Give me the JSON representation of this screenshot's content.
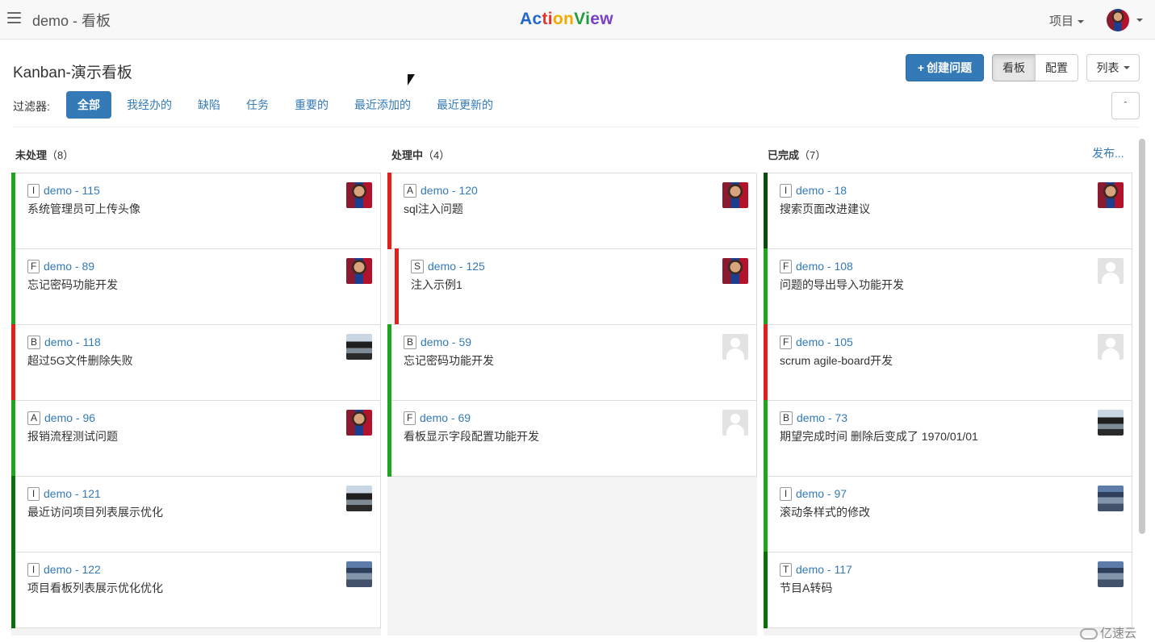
{
  "nav": {
    "app_title": "demo - 看板",
    "brand": [
      "Ac",
      "ti",
      "on",
      "Vi",
      "ew"
    ],
    "project_menu": "项目"
  },
  "header": {
    "board_title": "Kanban-演示看板",
    "create_button": "创建问题",
    "view_board": "看板",
    "view_config": "配置",
    "list_menu": "列表"
  },
  "filters": {
    "label": "过滤器:",
    "items": [
      "全部",
      "我经办的",
      "缺陷",
      "任务",
      "重要的",
      "最近添加的",
      "最近更新的"
    ],
    "active": "全部"
  },
  "columns": [
    {
      "name": "未处理",
      "count": "（8）",
      "cards": [
        {
          "type": "I",
          "key": "demo - 115",
          "title": "系统管理员可上传头像",
          "stripe": "#1ea41e",
          "avatar": "player"
        },
        {
          "type": "F",
          "key": "demo - 89",
          "title": "忘记密码功能开发",
          "stripe": "#1ea41e",
          "avatar": "player"
        },
        {
          "type": "B",
          "key": "demo - 118",
          "title": "超过5G文件删除失败",
          "stripe": "#e0201b",
          "avatar": "office"
        },
        {
          "type": "A",
          "key": "demo - 96",
          "title": "报销流程测试问题",
          "stripe": "#1ea41e",
          "avatar": "player"
        },
        {
          "type": "I",
          "key": "demo - 121",
          "title": "最近访问项目列表展示优化",
          "stripe": "#0d6e0d",
          "avatar": "office"
        },
        {
          "type": "I",
          "key": "demo - 122",
          "title": "项目看板列表展示优化优化",
          "stripe": "#0d6e0d",
          "avatar": "temple"
        }
      ]
    },
    {
      "name": "处理中",
      "count": "（4）",
      "cards": [
        {
          "type": "A",
          "key": "demo - 120",
          "title": "sql注入问题",
          "stripe": "#e0201b",
          "avatar": "player"
        },
        {
          "type": "S",
          "key": "demo - 125",
          "title": "注入示例1",
          "stripe": "#e0201b",
          "avatar": "player",
          "subtask": true
        },
        {
          "type": "B",
          "key": "demo - 59",
          "title": "忘记密码功能开发",
          "stripe": "#1ea41e",
          "avatar": "placeholder"
        },
        {
          "type": "F",
          "key": "demo - 69",
          "title": "看板显示字段配置功能开发",
          "stripe": "#1ea41e",
          "avatar": "placeholder"
        }
      ]
    },
    {
      "name": "已完成",
      "count": "（7）",
      "release_link": "发布...",
      "cards": [
        {
          "type": "I",
          "key": "demo - 18",
          "title": "搜索页面改进建议",
          "stripe": "#0d4a0d",
          "avatar": "player"
        },
        {
          "type": "F",
          "key": "demo - 108",
          "title": "问题的导出导入功能开发",
          "stripe": "#1ea41e",
          "avatar": "placeholder"
        },
        {
          "type": "F",
          "key": "demo - 105",
          "title": "scrum agile-board开发",
          "stripe": "#e0201b",
          "avatar": "placeholder"
        },
        {
          "type": "B",
          "key": "demo - 73",
          "title": "期望完成时间 删除后变成了 1970/01/01",
          "stripe": "#1ea41e",
          "avatar": "office"
        },
        {
          "type": "I",
          "key": "demo - 97",
          "title": "滚动条样式的修改",
          "stripe": "#1ea41e",
          "avatar": "temple"
        },
        {
          "type": "T",
          "key": "demo - 117",
          "title": "节目A转码",
          "stripe": "#0d6e0d",
          "avatar": "temple"
        }
      ]
    }
  ],
  "watermark": "亿速云"
}
